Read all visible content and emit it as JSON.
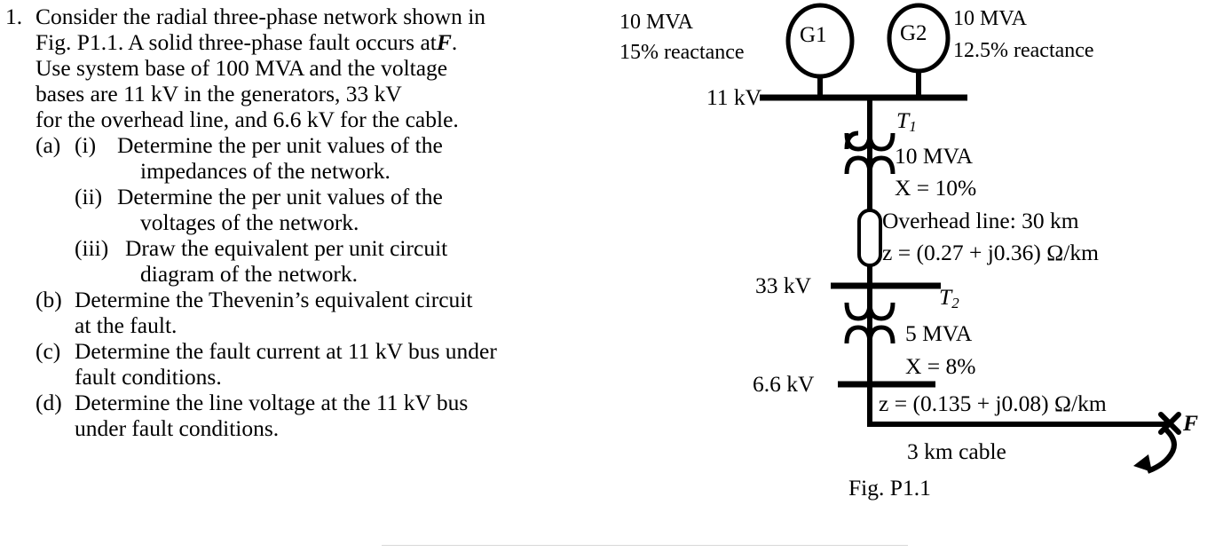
{
  "problem": {
    "number": "1.",
    "intro_lines": [
      "Consider the radial three-phase network shown in",
      "Fig. P1.1. A solid three-phase fault occurs at ",
      "Use system base of 100 MVA and the voltage",
      "bases are 11 kV in the generators, 33 kV",
      "for the overhead line, and 6.6 kV for the cable."
    ],
    "fault_symbol": "F",
    "fault_period": ".",
    "parts": [
      {
        "letter": "(a)",
        "roman": "(i)",
        "lines": [
          "Determine the per unit values of the",
          "impedances of the network."
        ]
      },
      {
        "letter": "",
        "roman": "(ii)",
        "lines": [
          "Determine the per unit values of the",
          "voltages of the network."
        ]
      },
      {
        "letter": "",
        "roman": "(iii)",
        "lines": [
          "Draw the equivalent per unit circuit",
          "diagram of the network."
        ]
      },
      {
        "letter": "(b)",
        "roman": "",
        "lines": [
          "Determine the Thevenin’s equivalent circuit",
          "at the fault."
        ]
      },
      {
        "letter": "(c)",
        "roman": "",
        "lines": [
          "Determine the fault current at 11 kV bus under",
          "fault conditions."
        ]
      },
      {
        "letter": "(d)",
        "roman": "",
        "lines": [
          "Determine the line voltage at the 11 kV bus",
          "under fault conditions."
        ]
      }
    ]
  },
  "diagram": {
    "caption": "Fig. P1.1",
    "generator_1": {
      "label": "G1",
      "rating": "10 MVA",
      "reactance": "15% reactance"
    },
    "generator_2": {
      "label": "G2",
      "rating": "10 MVA",
      "reactance": "12.5% reactance"
    },
    "bus_11kv": "11 kV",
    "bus_33kv": "33 kV",
    "bus_66kv": "6.6 kV",
    "transformer_1": {
      "name": "T",
      "name_sub": "1",
      "rating": "10 MVA",
      "reactance_var": "X",
      "reactance_eq": "= 10%"
    },
    "transformer_2": {
      "name": "T",
      "name_sub": "2",
      "rating": "5 MVA",
      "reactance_var": "X",
      "reactance_eq": "= 8%"
    },
    "overhead_line": {
      "title": "Overhead line: 30 km",
      "impedance_var": "z",
      "impedance_eq": "= (0.27 + j0.36) Ω/km"
    },
    "cable": {
      "impedance_var": "z",
      "impedance_eq": "= (0.135 + j0.08) Ω/km",
      "length_label": "3 km cable"
    },
    "fault_label": "F"
  },
  "colors": {
    "ink": "#000000",
    "page": "#ffffff",
    "rule": "#d8d8d8"
  }
}
